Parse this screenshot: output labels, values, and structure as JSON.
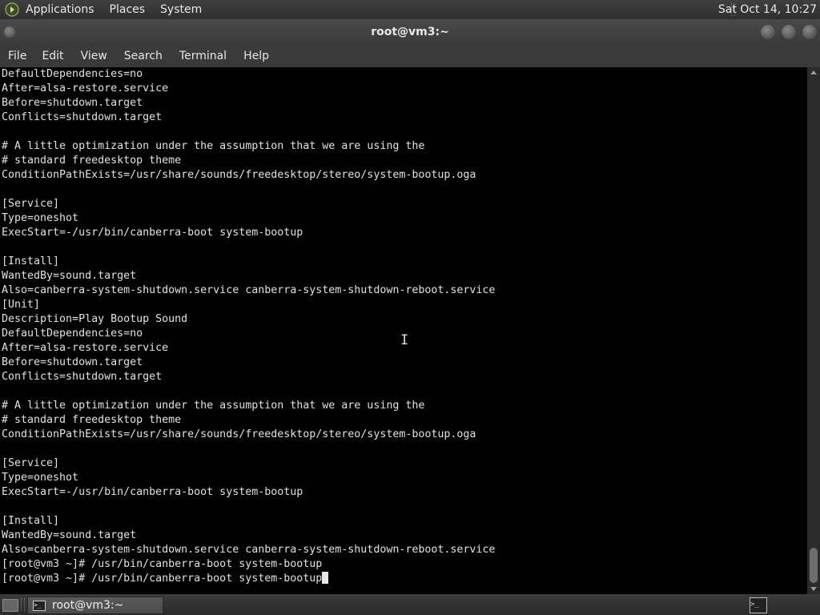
{
  "top_panel": {
    "menus": [
      "Applications",
      "Places",
      "System"
    ],
    "clock": "Sat Oct 14, 10:27"
  },
  "window": {
    "title": "root@vm3:~"
  },
  "menubar": {
    "items": [
      "File",
      "Edit",
      "View",
      "Search",
      "Terminal",
      "Help"
    ]
  },
  "terminal": {
    "lines": [
      "DefaultDependencies=no",
      "After=alsa-restore.service",
      "Before=shutdown.target",
      "Conflicts=shutdown.target",
      "",
      "# A little optimization under the assumption that we are using the",
      "# standard freedesktop theme",
      "ConditionPathExists=/usr/share/sounds/freedesktop/stereo/system-bootup.oga",
      "",
      "[Service]",
      "Type=oneshot",
      "ExecStart=-/usr/bin/canberra-boot system-bootup",
      "",
      "[Install]",
      "WantedBy=sound.target",
      "Also=canberra-system-shutdown.service canberra-system-shutdown-reboot.service",
      "[Unit]",
      "Description=Play Bootup Sound",
      "DefaultDependencies=no",
      "After=alsa-restore.service",
      "Before=shutdown.target",
      "Conflicts=shutdown.target",
      "",
      "# A little optimization under the assumption that we are using the",
      "# standard freedesktop theme",
      "ConditionPathExists=/usr/share/sounds/freedesktop/stereo/system-bootup.oga",
      "",
      "[Service]",
      "Type=oneshot",
      "ExecStart=-/usr/bin/canberra-boot system-bootup",
      "",
      "[Install]",
      "WantedBy=sound.target",
      "Also=canberra-system-shutdown.service canberra-system-shutdown-reboot.service",
      "[root@vm3 ~]# /usr/bin/canberra-boot system-bootup"
    ],
    "prompt_line": "[root@vm3 ~]# /usr/bin/canberra-boot system-bootup"
  },
  "taskbar": {
    "task_label": "root@vm3:~",
    "terminal_icon_glyph": ">_"
  },
  "icons": {
    "apps_icon": "applications-icon",
    "terminal_icon": "terminal-icon"
  }
}
